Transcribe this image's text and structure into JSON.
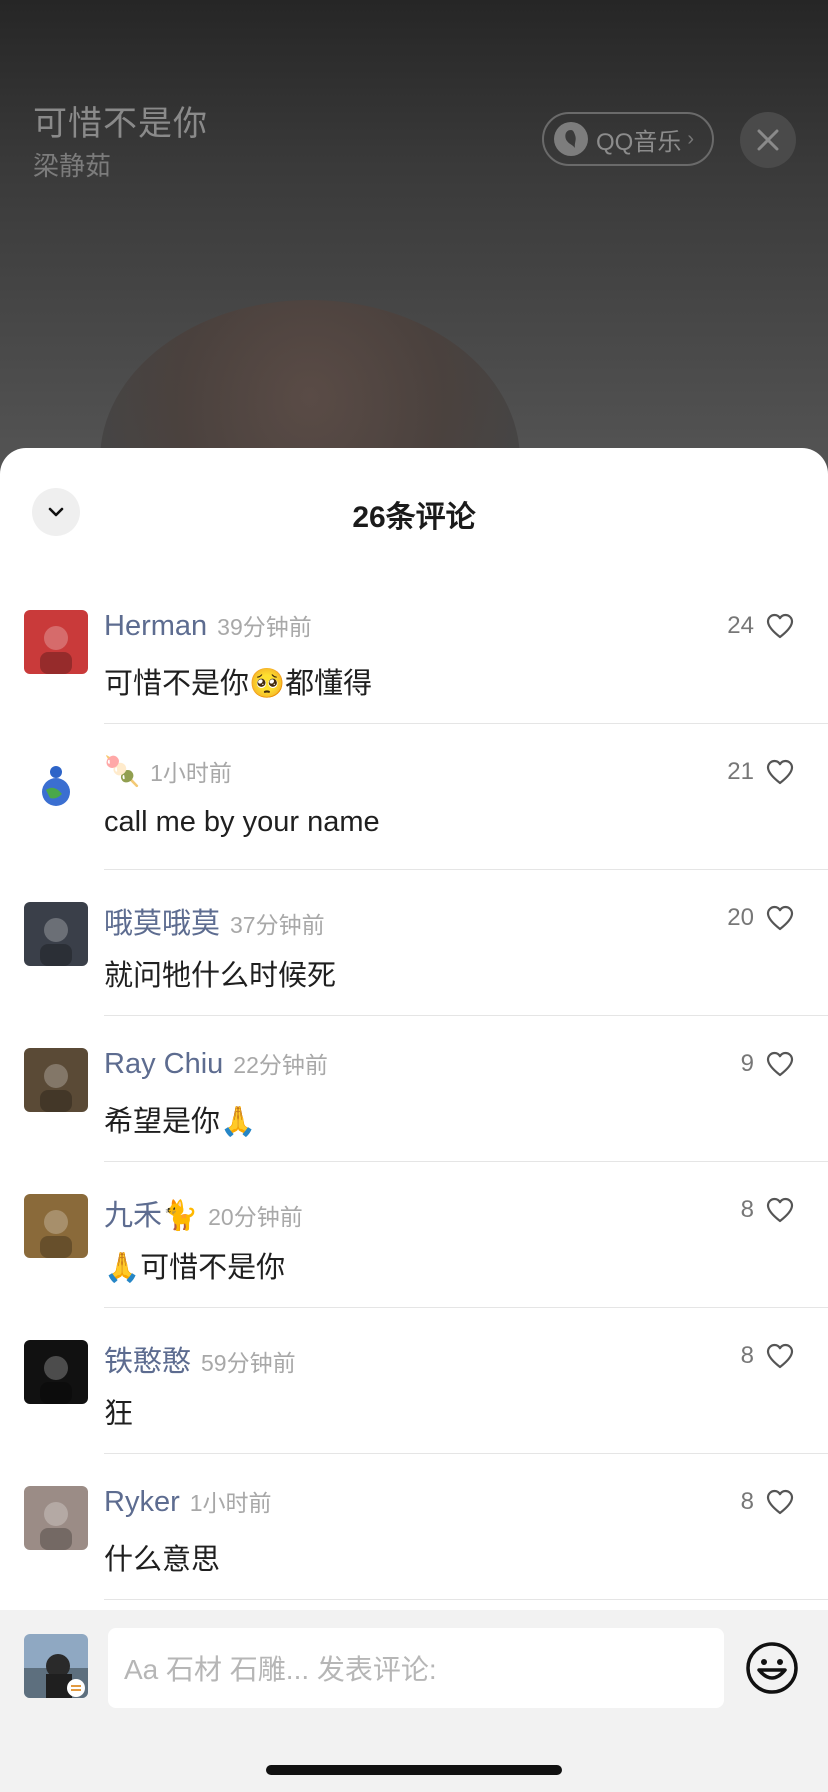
{
  "player": {
    "song_title": "可惜不是你",
    "artist": "梁静茹",
    "source_button": "QQ音乐",
    "source_chevron": "›"
  },
  "sheet": {
    "title": "26条评论"
  },
  "comments": [
    {
      "name": "Herman",
      "time": "39分钟前",
      "text": "可惜不是你🥺都懂得",
      "likes": "24",
      "avatar_color": "#c93a3a"
    },
    {
      "name": "🍡",
      "time": "1小时前",
      "text": "call me by your name",
      "likes": "21",
      "avatar_color": "#ffffff"
    },
    {
      "name": "哦莫哦莫",
      "time": "37分钟前",
      "text": "就问牠什么时候死",
      "likes": "20",
      "avatar_color": "#3a3f49"
    },
    {
      "name": "Ray Chiu",
      "time": "22分钟前",
      "text": "希望是你🙏",
      "likes": "9",
      "avatar_color": "#5a4a36"
    },
    {
      "name": "九禾🐈",
      "time": "20分钟前",
      "text": "🙏可惜不是你",
      "likes": "8",
      "avatar_color": "#8a6a3a"
    },
    {
      "name": "铁憨憨",
      "time": "59分钟前",
      "text": "狂",
      "likes": "8",
      "avatar_color": "#111111"
    },
    {
      "name": "Ryker",
      "time": "1小时前",
      "text": "什么意思",
      "likes": "8",
      "avatar_color": "#9b8c86"
    }
  ],
  "composer": {
    "placeholder": "Aa 石材 石雕... 发表评论:"
  },
  "colors": {
    "name": "#5d6c90",
    "time": "#a8a8a8",
    "accent_bg": "#f2f2f2"
  },
  "icons": {
    "close": "close-icon",
    "collapse": "chevron-down-icon",
    "like": "heart-outline-icon",
    "emoji": "smiley-icon"
  }
}
